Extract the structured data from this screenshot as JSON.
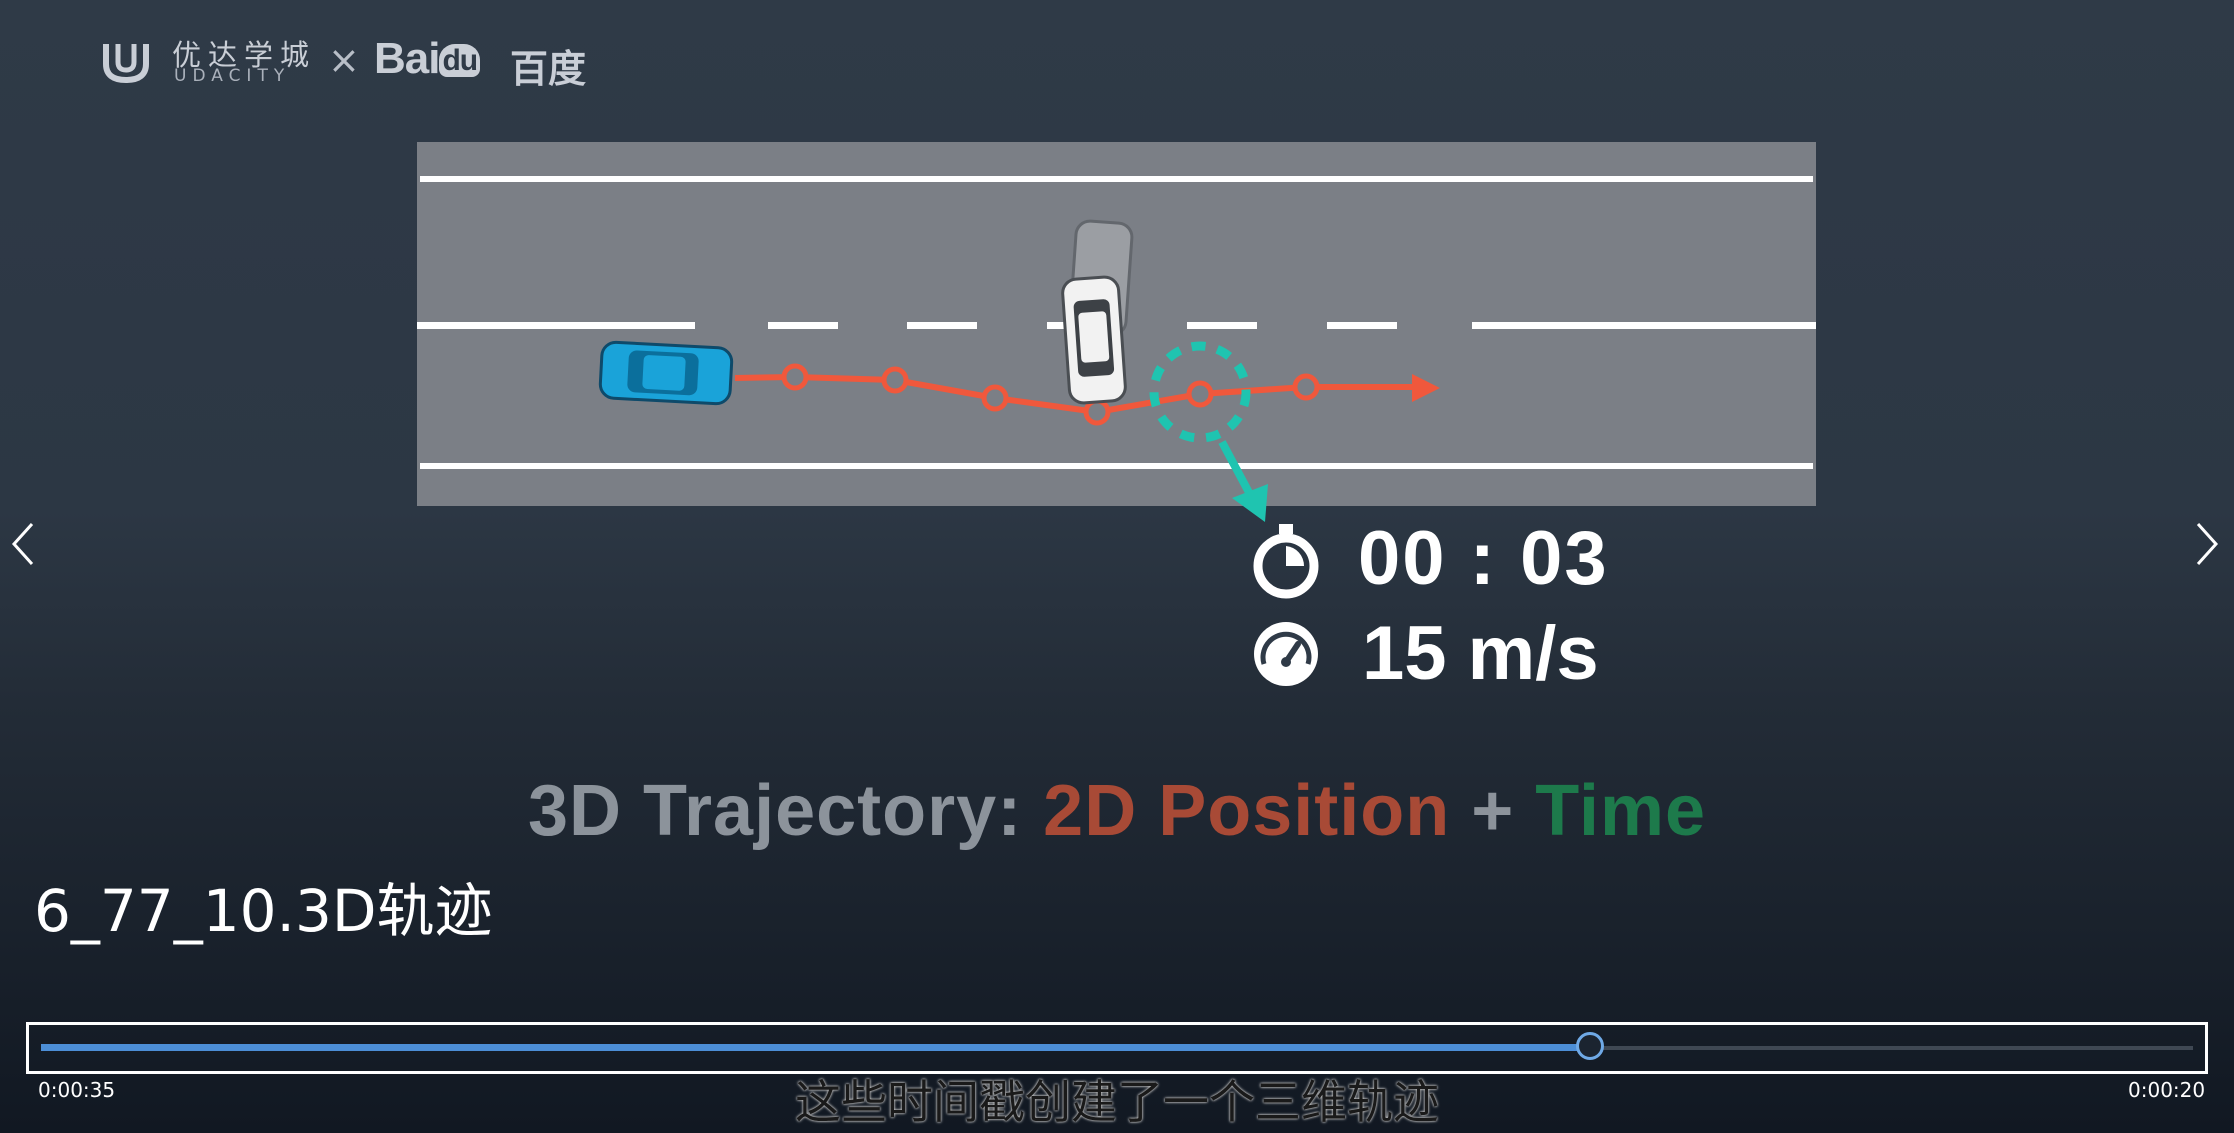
{
  "logo": {
    "udacity_cn": "优达学城",
    "udacity_en": "UDACITY",
    "separator": "×",
    "baidu": "Bai",
    "baidu_du": "du",
    "baidu_cn": "百度"
  },
  "overlay": {
    "time": "00 : 03",
    "speed": "15 m/s",
    "time_icon": "stopwatch-icon",
    "speed_icon": "speedometer-icon"
  },
  "caption": {
    "part1": "3D Trajectory: ",
    "part2": "2D Position",
    "part3": " + ",
    "part4": "Time"
  },
  "video_title": "6_77_10.3D轨迹",
  "player": {
    "elapsed": "0:00:35",
    "total": "0:00:20",
    "progress": 0.72,
    "subtitle": "这些时间戳创建了一个三维轨迹",
    "prev_icon": "chevron-left-icon",
    "next_icon": "chevron-right-icon"
  },
  "colors": {
    "road": "#7b7f86",
    "trajectory": "#f0583c",
    "highlight": "#1fc4b0",
    "ego_car": "#1aa3d9",
    "progress": "#4c8ed6"
  }
}
